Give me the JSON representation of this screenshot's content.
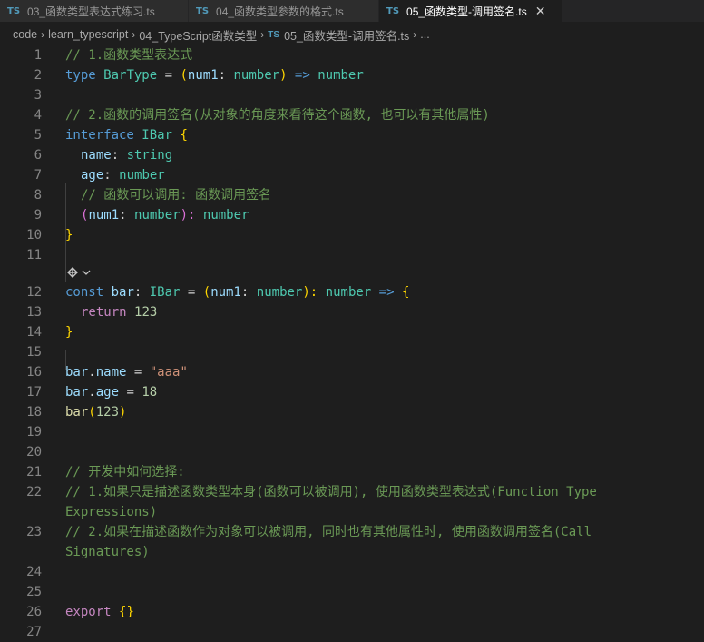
{
  "tabs": [
    {
      "badge": "TS",
      "label": "03_函数类型表达式练习.ts",
      "active": false
    },
    {
      "badge": "TS",
      "label": "04_函数类型参数的格式.ts",
      "active": false
    },
    {
      "badge": "TS",
      "label": "05_函数类型-调用签名.ts",
      "active": true,
      "close": "✕"
    }
  ],
  "breadcrumb": {
    "items": [
      "code",
      "learn_typescript",
      "04_TypeScript函数类型"
    ],
    "file_badge": "TS",
    "file": "05_函数类型-调用签名.ts",
    "tail": "..."
  },
  "line_numbers": [
    "1",
    "2",
    "3",
    "4",
    "5",
    "6",
    "7",
    "8",
    "9",
    "10",
    "11",
    "12",
    "13",
    "14",
    "15",
    "16",
    "17",
    "18",
    "19",
    "20",
    "21",
    "22",
    "23",
    "24",
    "25",
    "26",
    "27"
  ],
  "code": {
    "l1": "// 1.函数类型表达式",
    "l2": [
      "type",
      " ",
      "BarType",
      " = ",
      "(",
      "num1",
      ": ",
      "number",
      ")",
      " => ",
      "number"
    ],
    "l4": "// 2.函数的调用签名(从对象的角度来看待这个函数, 也可以有其他属性)",
    "l5": [
      "interface",
      " ",
      "IBar",
      " ",
      "{"
    ],
    "l6": [
      "name",
      ": ",
      "string"
    ],
    "l7": [
      "age",
      ": ",
      "number"
    ],
    "l8": "// 函数可以调用: 函数调用签名",
    "l9": [
      "(",
      "num1",
      ": ",
      "number",
      "): ",
      "number"
    ],
    "l10": "}",
    "l12": [
      "const",
      " ",
      "bar",
      ": ",
      "IBar",
      " = ",
      "(",
      "num1",
      ": ",
      "number",
      "): ",
      "number",
      " => ",
      "{"
    ],
    "l13": [
      "return",
      " ",
      "123"
    ],
    "l14": "}",
    "l16": [
      "bar",
      ".",
      "name",
      " = ",
      "\"aaa\""
    ],
    "l17": [
      "bar",
      ".",
      "age",
      " = ",
      "18"
    ],
    "l18": [
      "bar",
      "(",
      "123",
      ")"
    ],
    "l21": "// 开发中如何选择:",
    "l22a": "// 1.如果只是描述函数类型本身(函数可以被调用), 使用函数类型表达式(Function Type",
    "l22b": "Expressions)",
    "l23a": "// 2.如果在描述函数作为对象可以被调用, 同时也有其他属性时, 使用函数调用签名(Call",
    "l23b": "Signatures)",
    "l26": [
      "export",
      " ",
      "{}"
    ]
  },
  "codelens_icon": "copilot-sparkle-icon"
}
